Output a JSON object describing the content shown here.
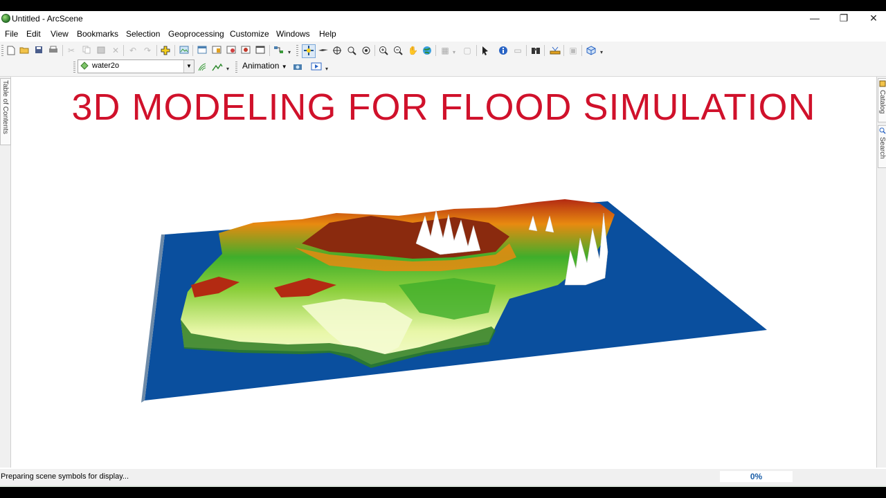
{
  "window": {
    "title": "Untitled - ArcScene",
    "controls": {
      "minimize": "—",
      "restore": "❐",
      "close": "✕"
    }
  },
  "menubar": [
    "File",
    "Edit",
    "View",
    "Bookmarks",
    "Selection",
    "Geoprocessing",
    "Customize",
    "Windows",
    "Help"
  ],
  "toolbar": {
    "row1_icons": [
      "new-document",
      "open-folder",
      "save",
      "print",
      "cut",
      "copy",
      "paste",
      "delete",
      "undo",
      "redo",
      "add-data",
      "scene-properties",
      "layer-properties",
      "bookmark",
      "export",
      "view-window",
      "fly-tool",
      "navigate",
      "fly",
      "target-center",
      "zoom-to-target",
      "set-observer",
      "zoom-in",
      "zoom-out",
      "pan",
      "full-extent",
      "select-features",
      "clear-selection",
      "select-elements",
      "identify",
      "html-popup",
      "find",
      "measure",
      "edit-tool",
      "3d-effects"
    ],
    "layer_selector": {
      "value": "water2o"
    },
    "animation_label": "Animation"
  },
  "left_dock": {
    "tab_label": "Table of Contents"
  },
  "right_dock": {
    "tabs": [
      "Catalog",
      "Search"
    ]
  },
  "scene": {
    "title_overlay": "3D MODELING FOR FLOOD SIMULATION",
    "colors": {
      "water": "#0a4f9e",
      "low_land": "#e8f7a8",
      "mid_land": "#3fae2b",
      "high_land": "#e88a10",
      "ridge": "#b32a12",
      "peak": "#ffffff"
    }
  },
  "statusbar": {
    "message": "Preparing scene symbols for display...",
    "progress": 0,
    "progress_label": "0%"
  }
}
